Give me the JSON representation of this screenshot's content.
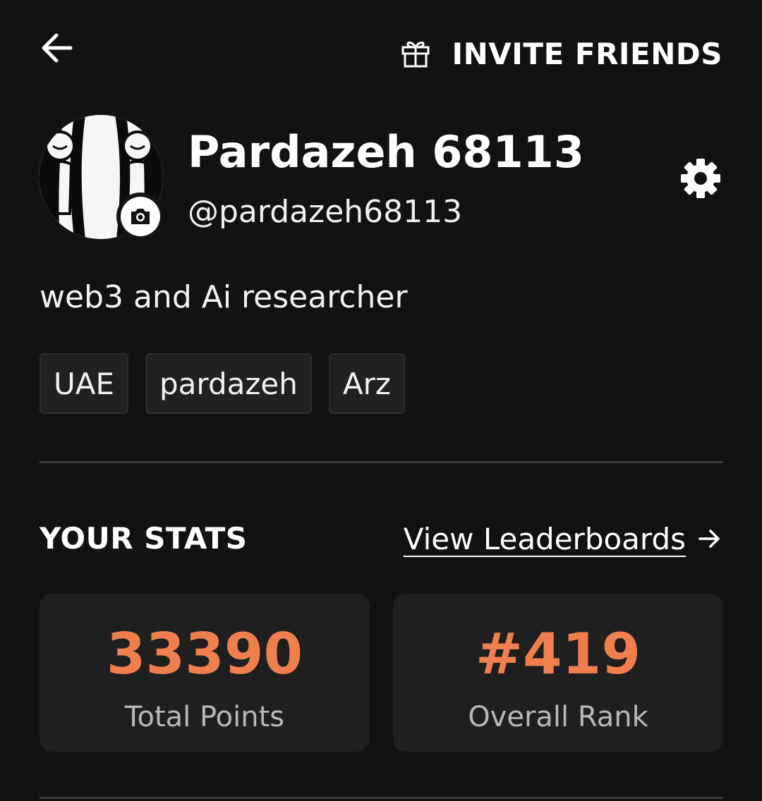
{
  "header": {
    "back_icon": "arrow-left-icon",
    "invite_icon": "gift-icon",
    "invite_label": "INVITE FRIENDS"
  },
  "profile": {
    "display_name": "Pardazeh 68113",
    "handle": "@pardazeh68113",
    "bio": "web3 and Ai researcher",
    "avatar_badge_icon": "camera-icon",
    "settings_icon": "gear-icon",
    "tags": [
      "UAE",
      "pardazeh",
      "Arz"
    ]
  },
  "stats": {
    "title": "YOUR STATS",
    "leaderboards_link": "View Leaderboards",
    "leaderboards_icon": "arrow-right-icon",
    "cards": [
      {
        "value": "33390",
        "label": "Total Points"
      },
      {
        "value": "#419",
        "label": "Overall Rank"
      }
    ]
  },
  "colors": {
    "background": "#121212",
    "card_background": "#1f1f1f",
    "accent": "#f07f4e",
    "muted_text": "#b8b8b8"
  }
}
